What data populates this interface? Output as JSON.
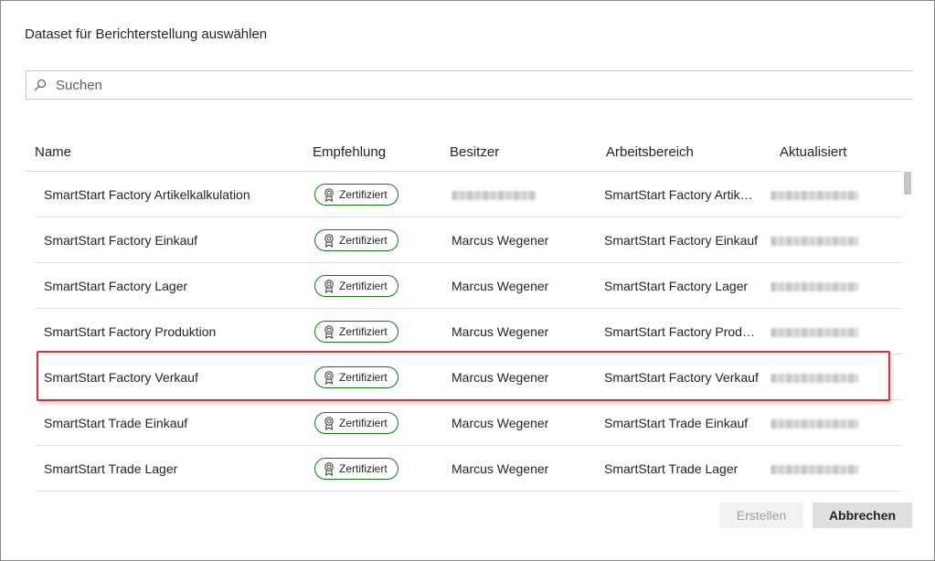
{
  "dialog": {
    "title": "Dataset für Berichterstellung auswählen",
    "search": {
      "placeholder": "Suchen",
      "value": ""
    },
    "columns": {
      "name": "Name",
      "recommendation": "Empfehlung",
      "owner": "Besitzer",
      "workspace": "Arbeitsbereich",
      "updated": "Aktualisiert"
    },
    "rows": [
      {
        "name": "SmartStart Factory Artikelkalkulation",
        "badge": "Zertifiziert",
        "owner": "",
        "workspace": "SmartStart Factory Artikel...",
        "updated": ""
      },
      {
        "name": "SmartStart Factory Einkauf",
        "badge": "Zertifiziert",
        "owner": "Marcus Wegener",
        "workspace": "SmartStart Factory Einkauf",
        "updated": ""
      },
      {
        "name": "SmartStart Factory Lager",
        "badge": "Zertifiziert",
        "owner": "Marcus Wegener",
        "workspace": "SmartStart Factory Lager",
        "updated": ""
      },
      {
        "name": "SmartStart Factory Produktion",
        "badge": "Zertifiziert",
        "owner": "Marcus Wegener",
        "workspace": "SmartStart Factory Produ...",
        "updated": ""
      },
      {
        "name": "SmartStart Factory Verkauf",
        "badge": "Zertifiziert",
        "owner": "Marcus Wegener",
        "workspace": "SmartStart Factory Verkauf",
        "updated": ""
      },
      {
        "name": "SmartStart Trade Einkauf",
        "badge": "Zertifiziert",
        "owner": "Marcus Wegener",
        "workspace": "SmartStart Trade Einkauf",
        "updated": ""
      },
      {
        "name": "SmartStart Trade Lager",
        "badge": "Zertifiziert",
        "owner": "Marcus Wegener",
        "workspace": "SmartStart Trade Lager",
        "updated": ""
      }
    ],
    "buttons": {
      "create": "Erstellen",
      "cancel": "Abbrechen"
    },
    "colors": {
      "certified": "#107c10",
      "highlight": "#d13438",
      "border": "#8a8886"
    },
    "icons": {
      "search": "search-icon",
      "certified": "certified-ribbon-icon"
    }
  }
}
